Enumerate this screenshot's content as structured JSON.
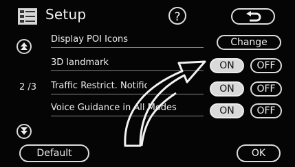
{
  "header": {
    "title": "Setup",
    "help_label": "?"
  },
  "page_indicator": "2 /3",
  "rows": [
    {
      "label": "Display POI Icons",
      "button": "Change"
    },
    {
      "label": "3D landmark",
      "on_label": "ON",
      "off_label": "OFF",
      "selected": "ON"
    },
    {
      "label": "Traffic Restrict. Notifica",
      "on_label": "ON",
      "off_label": "OFF",
      "selected": "ON"
    },
    {
      "label": "Voice Guidance in All Modes",
      "on_label": "ON",
      "off_label": "OFF",
      "selected": "ON"
    }
  ],
  "footer": {
    "default_label": "Default",
    "ok_label": "OK"
  },
  "icons": {
    "menu": "list-icon",
    "back": "return-arrow-icon",
    "scroll_up": "scroll-up-icon",
    "scroll_down": "scroll-down-icon",
    "pointer": "curved-arrow-icon"
  },
  "colors": {
    "background": "#050505",
    "selected_button": "#d9d9d9",
    "outline": "#dcdcdc"
  }
}
